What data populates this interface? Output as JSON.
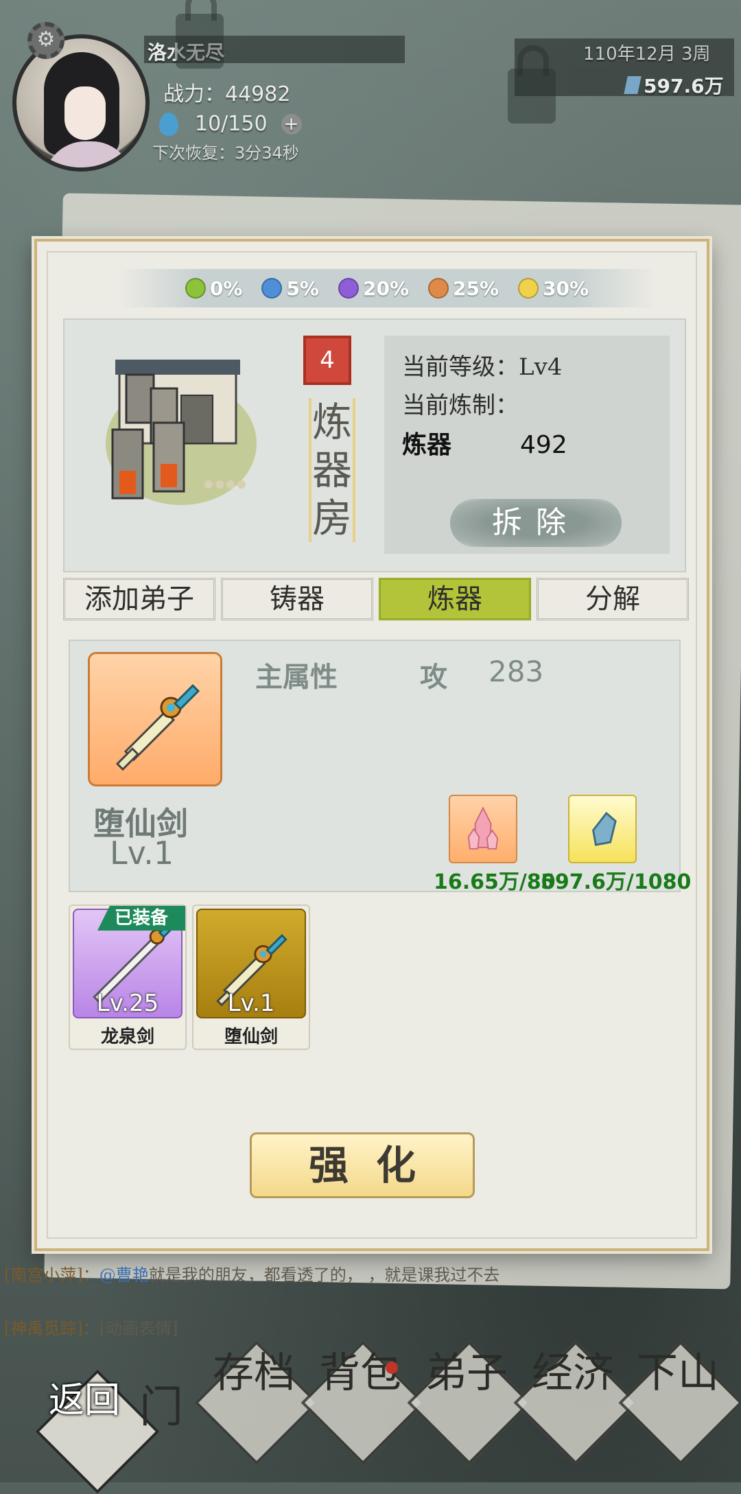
{
  "player": {
    "name": "洛水无尽",
    "power_label": "战力：",
    "power_value": "44982",
    "stamina": "10/150",
    "recovery": "下次恢复：3分34秒"
  },
  "date": "110年12月  3周",
  "currency": "597.6万",
  "bonus_bar": [
    {
      "label": "0%",
      "color": "#8cc33a"
    },
    {
      "label": "5%",
      "color": "#4e8fd8"
    },
    {
      "label": "20%",
      "color": "#8f5dd6"
    },
    {
      "label": "25%",
      "color": "#e08a4a"
    },
    {
      "label": "30%",
      "color": "#f0d24a"
    }
  ],
  "building": {
    "level_badge": "4",
    "name_chars": [
      "炼",
      "器",
      "房"
    ],
    "current_level": "当前等级：Lv4",
    "current_craft": "当前炼制：",
    "craft_item": "炼器",
    "craft_value": "492",
    "remove_button": "拆除"
  },
  "tabs": [
    {
      "label": "添加弟子",
      "active": false
    },
    {
      "label": "铸器",
      "active": false
    },
    {
      "label": "炼器",
      "active": true
    },
    {
      "label": "分解",
      "active": false
    }
  ],
  "selected_item": {
    "name": "堕仙剑",
    "level": "Lv.1",
    "main_attr_label": "主属性",
    "attr_type": "攻",
    "attr_value": "283",
    "materials": [
      {
        "icon": "pink-crystal-icon",
        "count": "16.65万/80"
      },
      {
        "icon": "blue-stone-icon",
        "count": "597.6万/1080"
      }
    ]
  },
  "inventory": [
    {
      "name": "龙泉剑",
      "level": "Lv.25",
      "equipped": true,
      "tag": "已装备",
      "frame_color": "#c8a0ec"
    },
    {
      "name": "堕仙剑",
      "level": "Lv.1",
      "equipped": false,
      "tag": "",
      "frame_color": "#b8901c"
    }
  ],
  "enhance_button": "强化",
  "chat": [
    {
      "sender": "[南宫小萍]：",
      "mention": "@曹艳",
      "text": "就是我的朋友，都看透了的，  ，就是课我过不去"
    },
    {
      "sender": "[神禹觅踪]：",
      "mention": "",
      "text": "[动画表情]"
    }
  ],
  "nav": {
    "back": "返回",
    "items": [
      "门",
      "存档",
      "背包",
      "弟子",
      "经济",
      "下山"
    ]
  },
  "colors": {
    "accent_green": "#b3c43a",
    "frame_gold": "#cdb27a",
    "material_green": "#1a7a1a"
  }
}
